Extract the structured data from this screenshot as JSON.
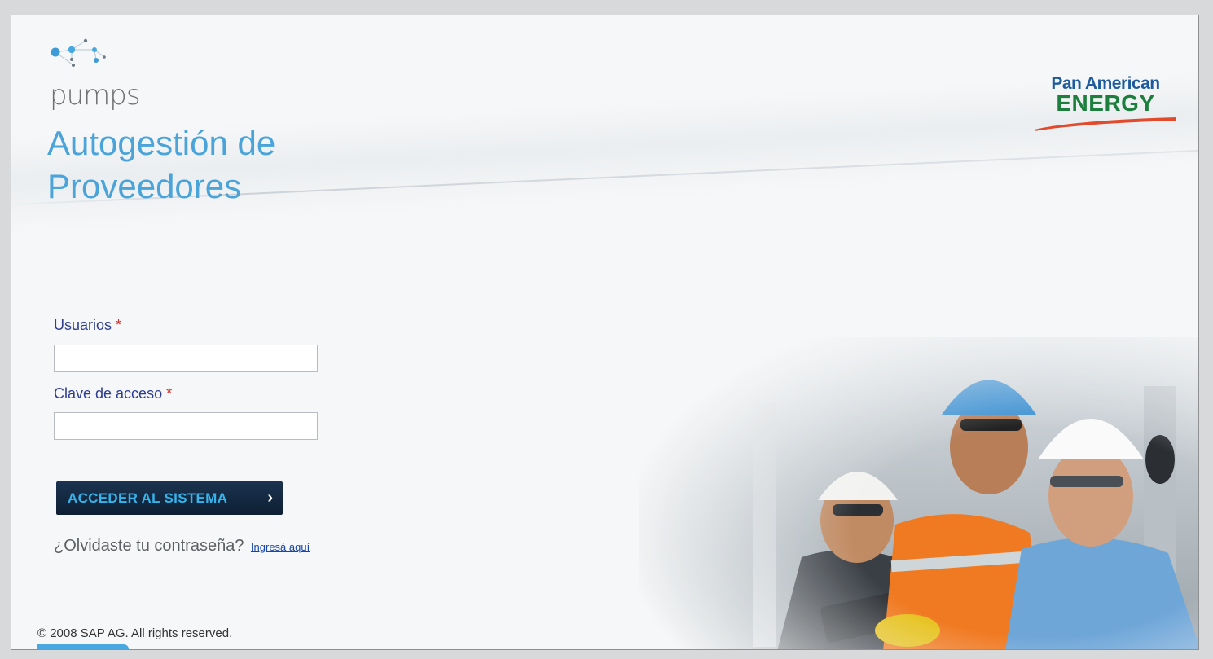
{
  "brand": {
    "product_word": "pumps",
    "title_line1": "Autogestión de",
    "title_line2": "Proveedores",
    "partner_line1": "Pan American",
    "partner_line2": "ENERGY",
    "colors": {
      "accent_blue": "#4aa3d9",
      "partner_blue": "#1e5a9e",
      "partner_green": "#1d7f3e",
      "partner_red": "#e14b2c"
    }
  },
  "login": {
    "user_label": "Usuarios",
    "user_value": "",
    "password_label": "Clave de acceso",
    "password_value": "",
    "required_mark": "*",
    "submit_label": "ACCEDER AL SISTEMA",
    "submit_icon": "chevron-right-icon",
    "forgot_question": "¿Olvidaste tu contraseña?",
    "forgot_link": "Ingresá aquí"
  },
  "footer": {
    "copyright": "© 2008 SAP AG. All rights reserved."
  },
  "hero_image": {
    "subject": "three-workers-hardhats-photo"
  }
}
